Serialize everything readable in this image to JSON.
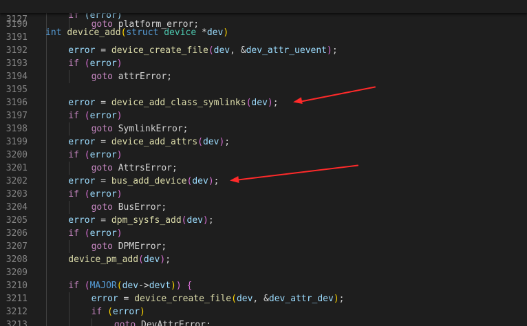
{
  "editor": {
    "sticky": {
      "num": "3127",
      "tokens": [
        {
          "t": "int",
          "c": "kw"
        },
        {
          "t": " ",
          "c": "p"
        },
        {
          "t": "device_add",
          "c": "fn"
        },
        {
          "t": "(",
          "c": "b1"
        },
        {
          "t": "struct",
          "c": "kw"
        },
        {
          "t": " ",
          "c": "p"
        },
        {
          "t": "device",
          "c": "type"
        },
        {
          "t": " *",
          "c": "p"
        },
        {
          "t": "dev",
          "c": "var"
        },
        {
          "t": ")",
          "c": "b1"
        }
      ]
    },
    "partial_line": {
      "tokens": [
        {
          "t": "if",
          "c": "ctl"
        },
        {
          "t": " ",
          "c": "p"
        },
        {
          "t": "(error)",
          "c": "var"
        }
      ]
    },
    "lines": [
      {
        "num": "3190",
        "indent": 2,
        "tokens": [
          {
            "t": "goto",
            "c": "ctl"
          },
          {
            "t": " platform_error;",
            "c": "p"
          }
        ]
      },
      {
        "num": "3191",
        "indent": 0,
        "tokens": []
      },
      {
        "num": "3192",
        "indent": 1,
        "tokens": [
          {
            "t": "error",
            "c": "var"
          },
          {
            "t": " = ",
            "c": "p"
          },
          {
            "t": "device_create_file",
            "c": "fn"
          },
          {
            "t": "(",
            "c": "b2"
          },
          {
            "t": "dev",
            "c": "var"
          },
          {
            "t": ", &",
            "c": "p"
          },
          {
            "t": "dev_attr_uevent",
            "c": "var"
          },
          {
            "t": ")",
            "c": "b2"
          },
          {
            "t": ";",
            "c": "p"
          }
        ]
      },
      {
        "num": "3193",
        "indent": 1,
        "tokens": [
          {
            "t": "if",
            "c": "ctl"
          },
          {
            "t": " ",
            "c": "p"
          },
          {
            "t": "(",
            "c": "b2"
          },
          {
            "t": "error",
            "c": "var"
          },
          {
            "t": ")",
            "c": "b2"
          }
        ]
      },
      {
        "num": "3194",
        "indent": 2,
        "tokens": [
          {
            "t": "goto",
            "c": "ctl"
          },
          {
            "t": " attrError;",
            "c": "p"
          }
        ]
      },
      {
        "num": "3195",
        "indent": 0,
        "tokens": []
      },
      {
        "num": "3196",
        "indent": 1,
        "tokens": [
          {
            "t": "error",
            "c": "var"
          },
          {
            "t": " = ",
            "c": "p"
          },
          {
            "t": "device_add_class_symlinks",
            "c": "fn"
          },
          {
            "t": "(",
            "c": "b2"
          },
          {
            "t": "dev",
            "c": "var"
          },
          {
            "t": ")",
            "c": "b2"
          },
          {
            "t": ";",
            "c": "p"
          }
        ]
      },
      {
        "num": "3197",
        "indent": 1,
        "tokens": [
          {
            "t": "if",
            "c": "ctl"
          },
          {
            "t": " ",
            "c": "p"
          },
          {
            "t": "(",
            "c": "b2"
          },
          {
            "t": "error",
            "c": "var"
          },
          {
            "t": ")",
            "c": "b2"
          }
        ]
      },
      {
        "num": "3198",
        "indent": 2,
        "tokens": [
          {
            "t": "goto",
            "c": "ctl"
          },
          {
            "t": " SymlinkError;",
            "c": "p"
          }
        ]
      },
      {
        "num": "3199",
        "indent": 1,
        "tokens": [
          {
            "t": "error",
            "c": "var"
          },
          {
            "t": " = ",
            "c": "p"
          },
          {
            "t": "device_add_attrs",
            "c": "fn"
          },
          {
            "t": "(",
            "c": "b2"
          },
          {
            "t": "dev",
            "c": "var"
          },
          {
            "t": ")",
            "c": "b2"
          },
          {
            "t": ";",
            "c": "p"
          }
        ]
      },
      {
        "num": "3200",
        "indent": 1,
        "tokens": [
          {
            "t": "if",
            "c": "ctl"
          },
          {
            "t": " ",
            "c": "p"
          },
          {
            "t": "(",
            "c": "b2"
          },
          {
            "t": "error",
            "c": "var"
          },
          {
            "t": ")",
            "c": "b2"
          }
        ]
      },
      {
        "num": "3201",
        "indent": 2,
        "tokens": [
          {
            "t": "goto",
            "c": "ctl"
          },
          {
            "t": " AttrsError;",
            "c": "p"
          }
        ]
      },
      {
        "num": "3202",
        "indent": 1,
        "tokens": [
          {
            "t": "error",
            "c": "var"
          },
          {
            "t": " = ",
            "c": "p"
          },
          {
            "t": "bus_add_device",
            "c": "fn"
          },
          {
            "t": "(",
            "c": "b2"
          },
          {
            "t": "dev",
            "c": "var"
          },
          {
            "t": ")",
            "c": "b2"
          },
          {
            "t": ";",
            "c": "p"
          }
        ]
      },
      {
        "num": "3203",
        "indent": 1,
        "tokens": [
          {
            "t": "if",
            "c": "ctl"
          },
          {
            "t": " ",
            "c": "p"
          },
          {
            "t": "(",
            "c": "b2"
          },
          {
            "t": "error",
            "c": "var"
          },
          {
            "t": ")",
            "c": "b2"
          }
        ]
      },
      {
        "num": "3204",
        "indent": 2,
        "tokens": [
          {
            "t": "goto",
            "c": "ctl"
          },
          {
            "t": " BusError;",
            "c": "p"
          }
        ]
      },
      {
        "num": "3205",
        "indent": 1,
        "tokens": [
          {
            "t": "error",
            "c": "var"
          },
          {
            "t": " = ",
            "c": "p"
          },
          {
            "t": "dpm_sysfs_add",
            "c": "fn"
          },
          {
            "t": "(",
            "c": "b2"
          },
          {
            "t": "dev",
            "c": "var"
          },
          {
            "t": ")",
            "c": "b2"
          },
          {
            "t": ";",
            "c": "p"
          }
        ]
      },
      {
        "num": "3206",
        "indent": 1,
        "tokens": [
          {
            "t": "if",
            "c": "ctl"
          },
          {
            "t": " ",
            "c": "p"
          },
          {
            "t": "(",
            "c": "b2"
          },
          {
            "t": "error",
            "c": "var"
          },
          {
            "t": ")",
            "c": "b2"
          }
        ]
      },
      {
        "num": "3207",
        "indent": 2,
        "tokens": [
          {
            "t": "goto",
            "c": "ctl"
          },
          {
            "t": " DPMError;",
            "c": "p"
          }
        ]
      },
      {
        "num": "3208",
        "indent": 1,
        "tokens": [
          {
            "t": "device_pm_add",
            "c": "fn"
          },
          {
            "t": "(",
            "c": "b2"
          },
          {
            "t": "dev",
            "c": "var"
          },
          {
            "t": ")",
            "c": "b2"
          },
          {
            "t": ";",
            "c": "p"
          }
        ]
      },
      {
        "num": "3209",
        "indent": 0,
        "tokens": []
      },
      {
        "num": "3210",
        "indent": 1,
        "tokens": [
          {
            "t": "if",
            "c": "ctl"
          },
          {
            "t": " ",
            "c": "p"
          },
          {
            "t": "(",
            "c": "b2"
          },
          {
            "t": "MAJOR",
            "c": "mac"
          },
          {
            "t": "(",
            "c": "b1"
          },
          {
            "t": "dev",
            "c": "var"
          },
          {
            "t": "->",
            "c": "p"
          },
          {
            "t": "devt",
            "c": "var"
          },
          {
            "t": ")",
            "c": "b1"
          },
          {
            "t": ")",
            "c": "b2"
          },
          {
            "t": " ",
            "c": "p"
          },
          {
            "t": "{",
            "c": "b2"
          }
        ]
      },
      {
        "num": "3211",
        "indent": 2,
        "tokens": [
          {
            "t": "error",
            "c": "var"
          },
          {
            "t": " = ",
            "c": "p"
          },
          {
            "t": "device_create_file",
            "c": "fn"
          },
          {
            "t": "(",
            "c": "b1"
          },
          {
            "t": "dev",
            "c": "var"
          },
          {
            "t": ", &",
            "c": "p"
          },
          {
            "t": "dev_attr_dev",
            "c": "var"
          },
          {
            "t": ")",
            "c": "b1"
          },
          {
            "t": ";",
            "c": "p"
          }
        ]
      },
      {
        "num": "3212",
        "indent": 2,
        "tokens": [
          {
            "t": "if",
            "c": "ctl"
          },
          {
            "t": " ",
            "c": "p"
          },
          {
            "t": "(",
            "c": "b1"
          },
          {
            "t": "error",
            "c": "var"
          },
          {
            "t": ")",
            "c": "b1"
          }
        ]
      },
      {
        "num": "3213",
        "indent": 3,
        "tokens": [
          {
            "t": "goto",
            "c": "ctl"
          },
          {
            "t": " DevAttrError;",
            "c": "p"
          }
        ]
      }
    ],
    "annotations": [
      {
        "label": "annotation-arrow-device-add-class-symlinks",
        "line": "3196",
        "color": "#ff2a2a"
      },
      {
        "label": "annotation-arrow-bus-add-device",
        "line": "3202",
        "color": "#ff2a2a"
      }
    ]
  }
}
